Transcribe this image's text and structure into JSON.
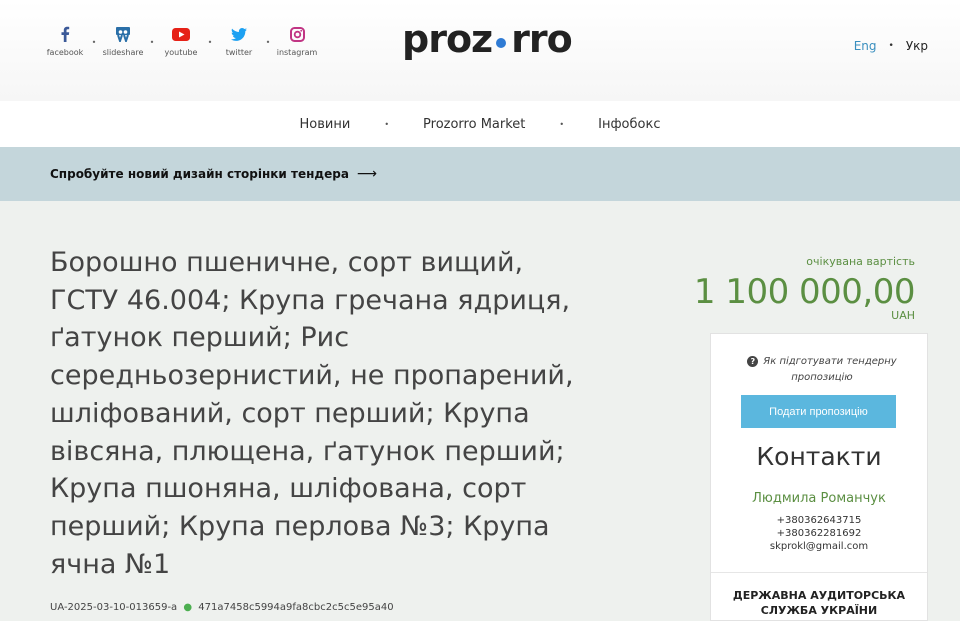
{
  "header": {
    "socials": [
      {
        "label": "facebook",
        "icon": "facebook-icon",
        "color": "#3b5998"
      },
      {
        "label": "slideshare",
        "icon": "slideshare-icon",
        "color": "#2a6fa8"
      },
      {
        "label": "youtube",
        "icon": "youtube-icon",
        "color": "#e62117"
      },
      {
        "label": "twitter",
        "icon": "twitter-icon",
        "color": "#1da1f2"
      },
      {
        "label": "instagram",
        "icon": "instagram-icon",
        "color": "#c13584"
      }
    ],
    "logo_left": "proz",
    "logo_right": "rro",
    "lang_en": "Eng",
    "lang_uk": "Укр"
  },
  "nav": {
    "items": [
      "Новини",
      "Prozorro Market",
      "Інфобокс"
    ]
  },
  "banner": {
    "text": "Спробуйте новий дизайн сторінки тендера",
    "arrow": "⟶"
  },
  "tender": {
    "title": "Борошно пшеничне, сорт вищий, ГСТУ 46.004; Крупа гречана ядриця, ґатунок перший; Рис середньозернистий, не пропарений, шліфований, сорт перший; Крупа вівсяна, плющена, ґатунок перший; Крупа пшоняна, шліфована, сорт перший; Крупа перлова №3; Крупа ячна №1",
    "id": "UA-2025-03-10-013659-a",
    "hash": "471a7458c5994a9fa8cbc2c5c5e95a40"
  },
  "value": {
    "label": "очікувана вартість",
    "amount": "1 100 000,00",
    "currency": "UAH"
  },
  "panel": {
    "howto": "Як підготувати тендерну пропозицію",
    "submit_label": "Подати пропозицію",
    "contacts_heading": "Контакти",
    "contact_name": "Людмила Романчук",
    "phone1": "+380362643715",
    "phone2": "+380362281692",
    "email": "skprokl@gmail.com",
    "org": "ДЕРЖАВНА АУДИТОРСЬКА СЛУЖБА УКРАЇНИ"
  },
  "colors": {
    "accent_green": "#5b8f42",
    "button_blue": "#5bb7de",
    "banner_bg": "#c4d6db",
    "page_bg": "#eef1ee"
  }
}
